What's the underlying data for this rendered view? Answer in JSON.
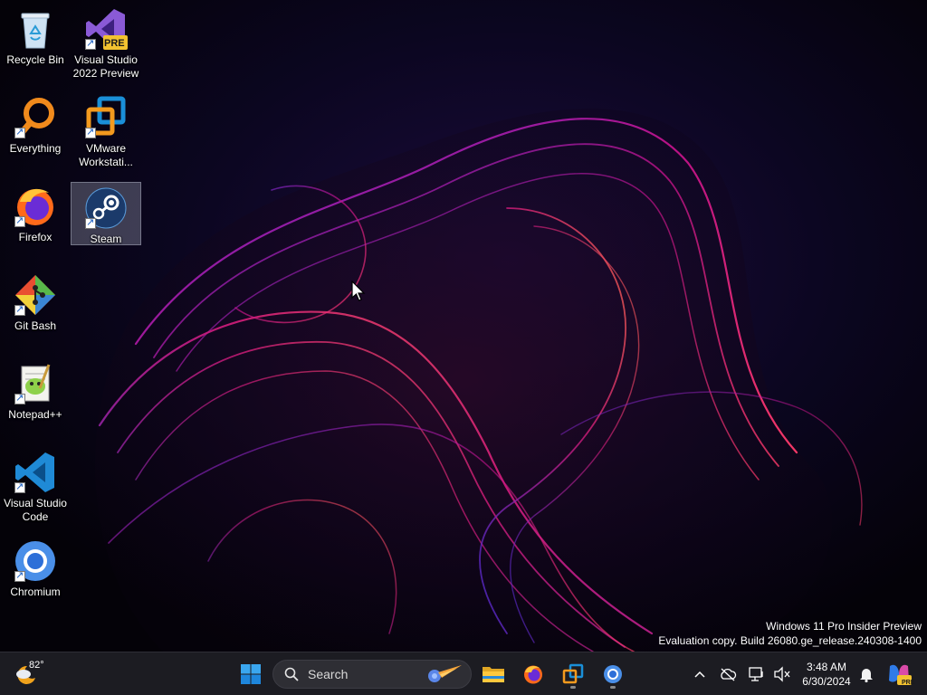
{
  "desktop": {
    "icons": [
      {
        "label": "Recycle Bin",
        "icon": "recycle-bin-icon"
      },
      {
        "label": "Visual Studio 2022 Preview",
        "icon": "visual-studio-preview-icon",
        "badge": "PRE"
      },
      {
        "label": "Everything",
        "icon": "everything-search-icon"
      },
      {
        "label": "VMware Workstati...",
        "icon": "vmware-icon"
      },
      {
        "label": "Firefox",
        "icon": "firefox-icon"
      },
      {
        "label": "Steam",
        "icon": "steam-icon"
      },
      {
        "label": "Git Bash",
        "icon": "git-bash-icon"
      },
      {
        "label": "Notepad++",
        "icon": "notepadpp-icon"
      },
      {
        "label": "Visual Studio Code",
        "icon": "vscode-icon"
      },
      {
        "label": "Chromium",
        "icon": "chromium-icon"
      }
    ],
    "selected": "Steam"
  },
  "watermark": {
    "line1": "Windows 11 Pro Insider Preview",
    "line2": "Evaluation copy. Build 26080.ge_release.240308-1400"
  },
  "taskbar": {
    "weather_temp": "82°",
    "search_placeholder": "Search",
    "pinned": [
      "windows-start-icon",
      "file-explorer-icon",
      "firefox-icon",
      "vmware-icon",
      "chromium-icon"
    ],
    "clock_time": "3:48 AM",
    "clock_date": "6/30/2024",
    "copilot_badge": "PRE"
  },
  "colors": {
    "taskbar_bg": "#1c1c22",
    "accent_blue": "#0078d4",
    "wallpaper_magenta": "#c0157a",
    "wallpaper_violet": "#6a2bd8"
  }
}
